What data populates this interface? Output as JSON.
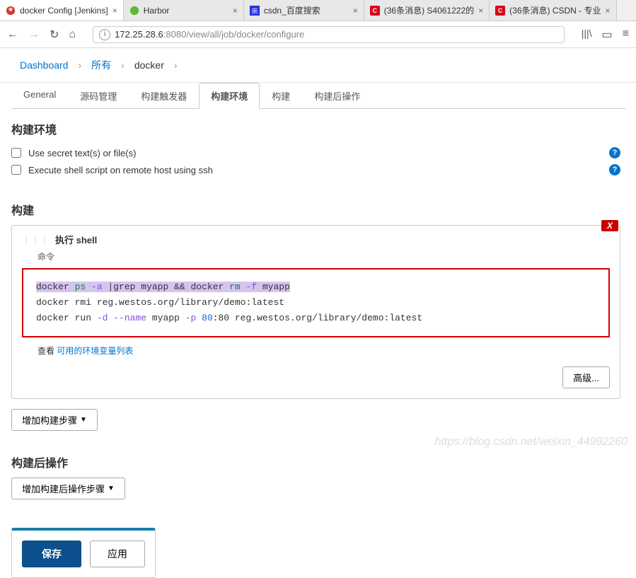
{
  "browser_tabs": [
    {
      "title": "docker Config [Jenkins]",
      "active": true
    },
    {
      "title": "Harbor",
      "active": false
    },
    {
      "title": "csdn_百度搜索",
      "active": false
    },
    {
      "title": "(36条消息) S4061222的",
      "active": false,
      "csdn": true
    },
    {
      "title": "(36条消息) CSDN - 专业",
      "active": false,
      "csdn": true
    }
  ],
  "url": {
    "host": "172.25.28.6",
    "port": ":8080",
    "path": "/view/all/job/docker/configure"
  },
  "breadcrumbs": {
    "dashboard": "Dashboard",
    "all": "所有",
    "job": "docker"
  },
  "config_tabs": [
    "General",
    "源码管理",
    "构建触发器",
    "构建环境",
    "构建",
    "构建后操作"
  ],
  "active_config_tab": "构建环境",
  "env_section": {
    "title": "构建环境",
    "cb1": "Use secret text(s) or file(s)",
    "cb2": "Execute shell script on remote host using ssh"
  },
  "build_section": {
    "title": "构建",
    "step_title": "执行 shell",
    "cmd_label": "命令",
    "shell_lines": {
      "l1p": "docker ",
      "l1c1": "ps",
      "l1f1": " -a",
      "l1m": " |grep myapp && docker ",
      "l1c2": "rm",
      "l1f2": " -f",
      "l1e": " myapp",
      "l2p": "docker rmi reg.westos.org/library/demo:latest",
      "l3p": "docker run ",
      "l3f1": "-d",
      "l3f2": " --name",
      "l3m": " myapp ",
      "l3f3": "-p",
      "l3n": " 80",
      "l3m2": ":80 reg.westos.org/library/demo:latest"
    },
    "see_vars_pre": "查看 ",
    "see_vars_link": "可用的环境变量列表",
    "advanced": "高级...",
    "add_step": "增加构建步骤"
  },
  "post_section": {
    "title": "构建后操作",
    "add_step": "增加构建后操作步骤"
  },
  "actions": {
    "save": "保存",
    "apply": "应用"
  },
  "watermark": "https://blog.csdn.net/weixin_44992260"
}
